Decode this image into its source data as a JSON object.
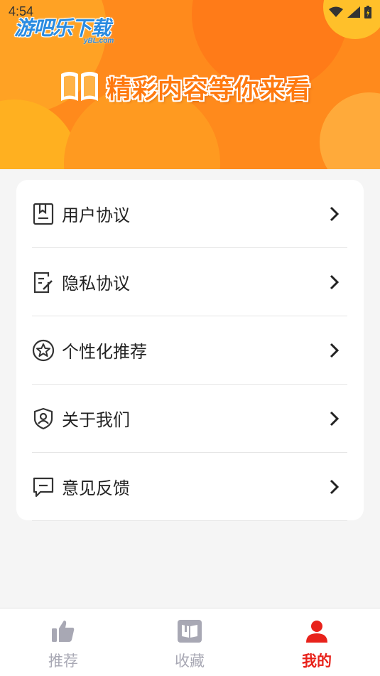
{
  "status_bar": {
    "time": "4:54"
  },
  "watermark": {
    "text": "游吧乐下载",
    "sub": "yBL.com"
  },
  "banner": {
    "slogan": "精彩内容等你来看"
  },
  "menu": {
    "items": [
      {
        "label": "用户协议",
        "icon": "document-icon"
      },
      {
        "label": "隐私协议",
        "icon": "edit-document-icon"
      },
      {
        "label": "个性化推荐",
        "icon": "star-circle-icon"
      },
      {
        "label": "关于我们",
        "icon": "shield-user-icon"
      },
      {
        "label": "意见反馈",
        "icon": "message-icon"
      }
    ]
  },
  "tabbar": {
    "tabs": [
      {
        "label": "推荐",
        "icon": "thumbs-up-icon",
        "active": false
      },
      {
        "label": "收藏",
        "icon": "book-icon",
        "active": false
      },
      {
        "label": "我的",
        "icon": "user-icon",
        "active": true
      }
    ]
  },
  "colors": {
    "accent": "#ff8a1c",
    "active_tab": "#e8221b",
    "inactive_tab": "#a8a8b4"
  }
}
